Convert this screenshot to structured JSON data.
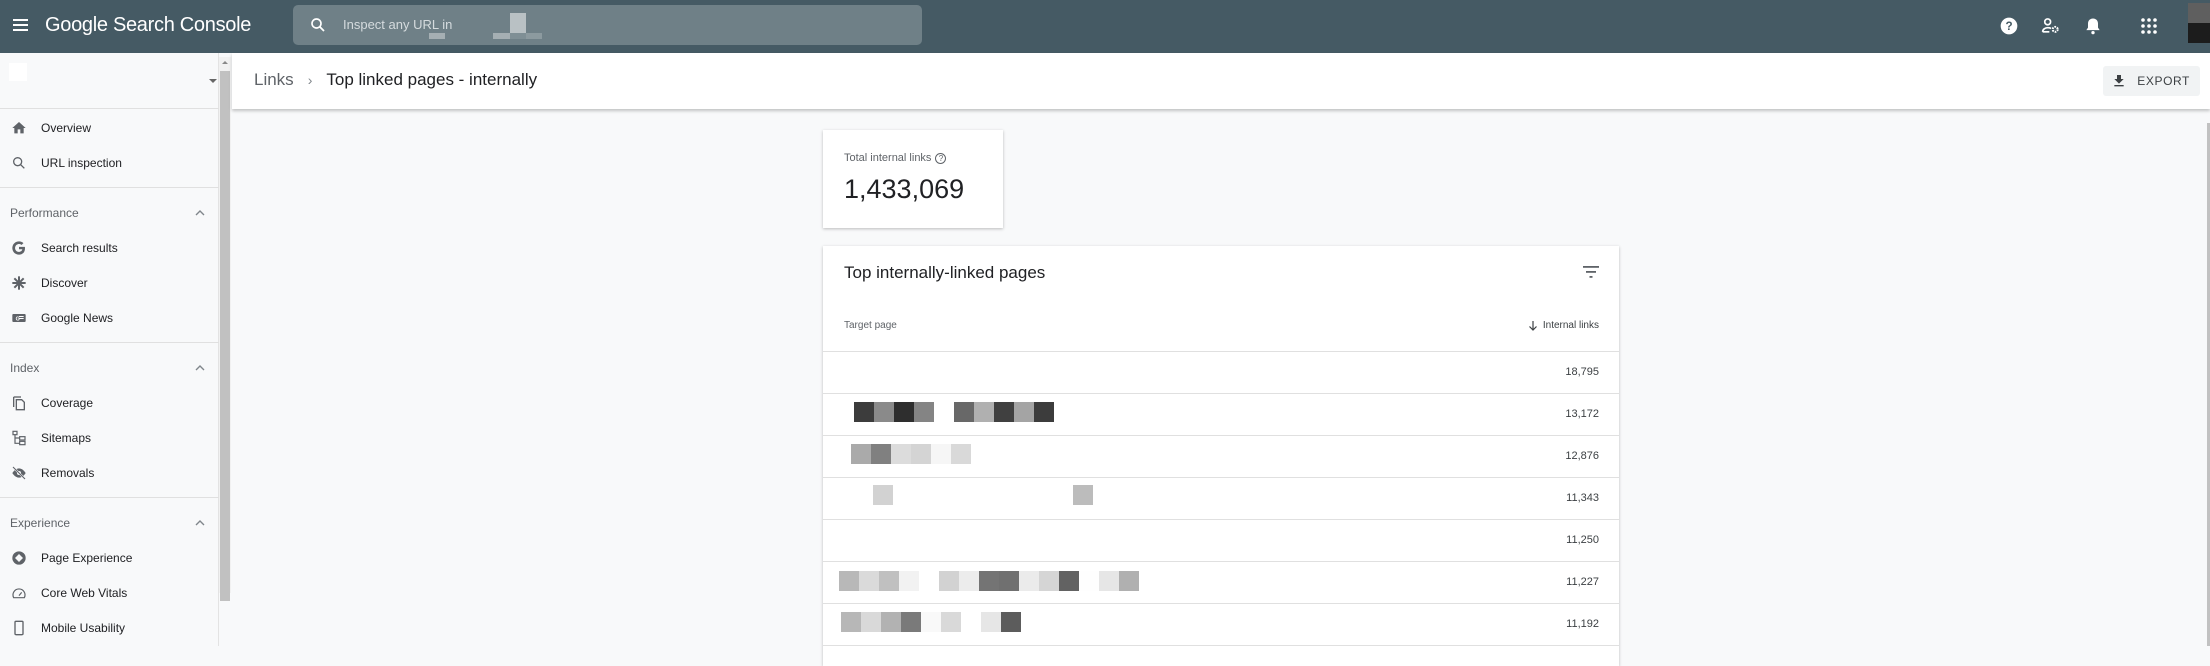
{
  "app": {
    "title": "Google Search Console",
    "icons": {
      "menu": "menu-icon",
      "help": "help-icon",
      "users_settings": "manage-users-icon",
      "notifications": "bell-icon",
      "apps": "apps-grid-icon"
    }
  },
  "search": {
    "placeholder": "Inspect any URL in"
  },
  "sidebar": {
    "top_items": [
      {
        "label": "Overview",
        "icon": "home-icon"
      },
      {
        "label": "URL inspection",
        "icon": "search-icon"
      }
    ],
    "sections": [
      {
        "label": "Performance",
        "items": [
          {
            "label": "Search results",
            "icon": "google-g-icon"
          },
          {
            "label": "Discover",
            "icon": "asterisk-icon"
          },
          {
            "label": "Google News",
            "icon": "news-icon"
          }
        ]
      },
      {
        "label": "Index",
        "items": [
          {
            "label": "Coverage",
            "icon": "copy-icon"
          },
          {
            "label": "Sitemaps",
            "icon": "sitemap-icon"
          },
          {
            "label": "Removals",
            "icon": "eye-off-icon"
          }
        ]
      },
      {
        "label": "Experience",
        "items": [
          {
            "label": "Page Experience",
            "icon": "page-experience-icon"
          },
          {
            "label": "Core Web Vitals",
            "icon": "gauge-icon"
          },
          {
            "label": "Mobile Usability",
            "icon": "phone-icon"
          }
        ]
      }
    ]
  },
  "header": {
    "breadcrumb_parent": "Links",
    "breadcrumb_separator": "›",
    "breadcrumb_current": "Top linked pages - internally",
    "export_label": "EXPORT"
  },
  "total_card": {
    "label": "Total internal links",
    "help": "?",
    "value": "1,433,069"
  },
  "table": {
    "title": "Top internally-linked pages",
    "columns": {
      "page": "Target page",
      "links": "Internal links"
    },
    "rows": [
      {
        "page": "",
        "links": "18,795"
      },
      {
        "page": "",
        "links": "13,172"
      },
      {
        "page": "",
        "links": "12,876"
      },
      {
        "page": "",
        "links": "11,343"
      },
      {
        "page": "",
        "links": "11,250"
      },
      {
        "page": "",
        "links": "11,227"
      },
      {
        "page": "",
        "links": "11,192"
      }
    ]
  }
}
